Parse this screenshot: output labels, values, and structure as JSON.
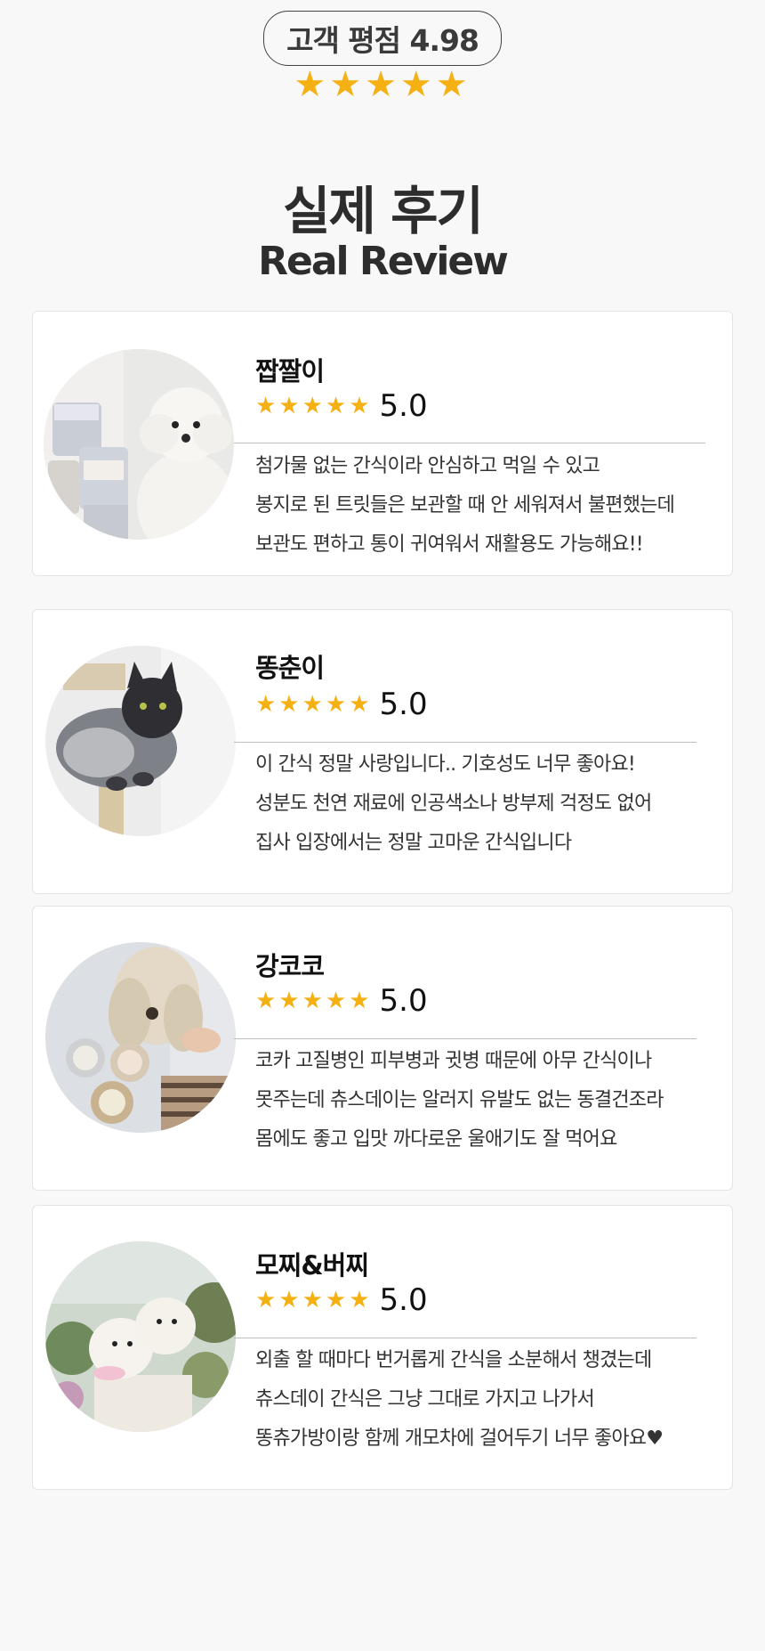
{
  "header": {
    "rating_label": "고객 평점 4.98",
    "stars": "★★★★★",
    "title_ko": "실제 후기",
    "title_en": "Real Review"
  },
  "colors": {
    "star": "#f5b013",
    "background": "#f8f8f8",
    "card": "#ffffff"
  },
  "reviews": [
    {
      "name": "짭짤이",
      "stars": "★★★★★",
      "score": "5.0",
      "photo_icon": "white-poodle-photo",
      "lines": [
        "첨가물 없는 간식이라 안심하고 먹일 수 있고",
        "봉지로 된 트릿들은 보관할 때 안 세워져서 불편했는데",
        "보관도 편하고 통이 귀여워서 재활용도 가능해요!!"
      ]
    },
    {
      "name": "똥춘이",
      "stars": "★★★★★",
      "score": "5.0",
      "photo_icon": "maine-coon-cat-photo",
      "lines": [
        "이 간식 정말 사랑입니다.. 기호성도 너무 좋아요!",
        "성분도 천연 재료에 인공색소나 방부제 걱정도 없어",
        "집사 입장에서는 정말 고마운 간식입니다"
      ]
    },
    {
      "name": "강코코",
      "stars": "★★★★★",
      "score": "5.0",
      "photo_icon": "cocker-spaniel-photo",
      "lines": [
        "코카 고질병인 피부병과 귓병 때문에 아무 간식이나",
        "못주는데 츄스데이는 알러지 유발도 없는 동결건조라",
        "몸에도 좋고 입맛 까다로운 울애기도 잘 먹어요"
      ]
    },
    {
      "name": "모찌&버찌",
      "stars": "★★★★★",
      "score": "5.0",
      "photo_icon": "pomeranians-photo",
      "lines": [
        "외출 할 때마다 번거롭게 간식을 소분해서 챙겼는데",
        "츄스데이 간식은 그냥 그대로 가지고 나가서",
        "똥츄가방이랑 함께 개모차에 걸어두기 너무 좋아요♥"
      ]
    }
  ]
}
